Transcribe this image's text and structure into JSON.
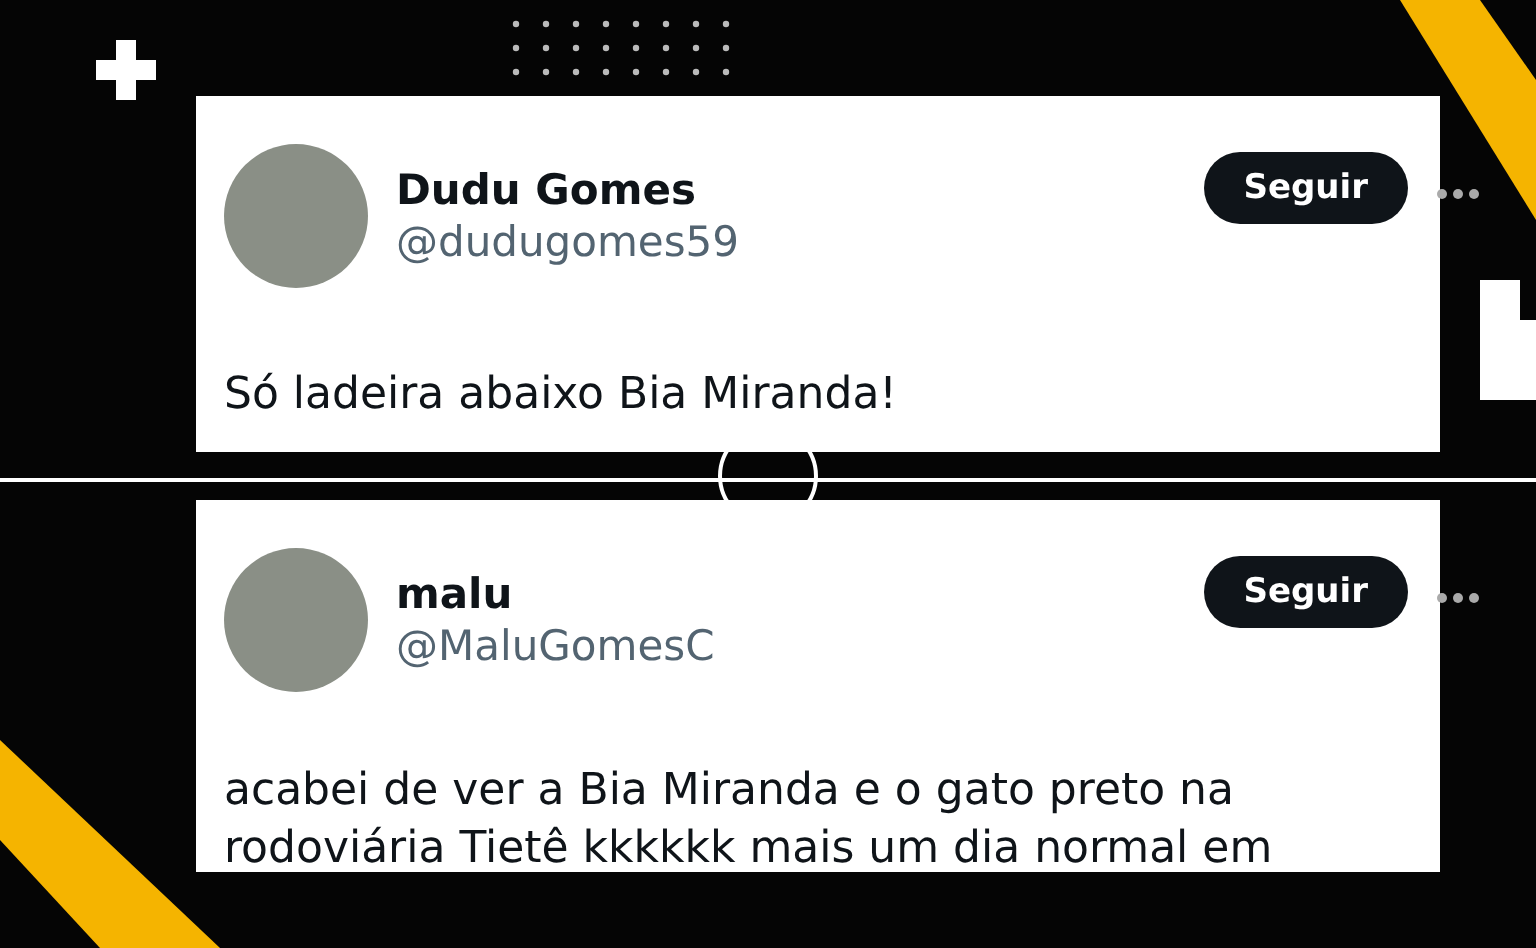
{
  "tweets": [
    {
      "name": "Dudu Gomes",
      "handle": "@dudugomes59",
      "follow_label": "Seguir",
      "text": "Só ladeira abaixo Bia Miranda!"
    },
    {
      "name": "malu",
      "handle": "@MaluGomesC",
      "follow_label": "Seguir",
      "text": "acabei de ver a Bia Miranda e o gato preto na rodoviária Tietê kkkkkk mais um dia normal em"
    }
  ]
}
